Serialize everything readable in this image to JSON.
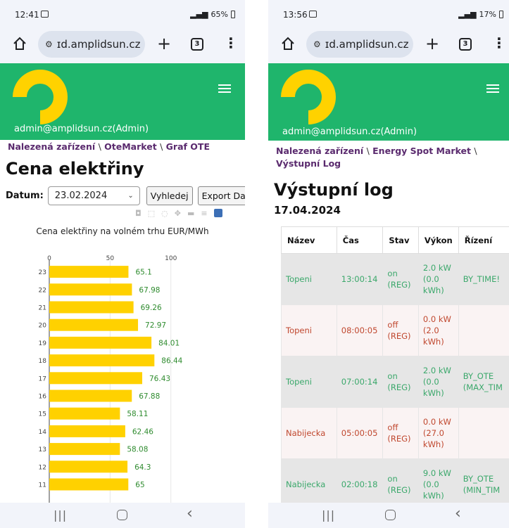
{
  "left": {
    "status": {
      "time": "12:41",
      "right": "65%"
    },
    "url": "ɪd.amplidsun.cz",
    "tab_count": "3",
    "admin": "admin@amplidsun.cz(Admin)",
    "breadcrumbs": [
      "Nalezená zařízení",
      "OteMarket",
      "Graf OTE"
    ],
    "title": "Cena elektřiny",
    "date_label": "Datum:",
    "date_value": "23.02.2024",
    "search_button": "Vyhledej",
    "export_button": "Export Dat",
    "chart_data": {
      "type": "bar",
      "orientation": "horizontal",
      "title": "Cena elektřiny na volném trhu EUR/MWh",
      "xlim": [
        0,
        110
      ],
      "x_ticks": [
        "0",
        "50",
        "100"
      ],
      "categories": [
        "23",
        "22",
        "21",
        "20",
        "19",
        "18",
        "17",
        "16",
        "15",
        "14",
        "13",
        "12",
        "11"
      ],
      "values": [
        65.1,
        67.98,
        69.26,
        72.97,
        84.01,
        86.44,
        76.43,
        67.88,
        58.11,
        62.46,
        58.08,
        64.3,
        65
      ],
      "labels": [
        "65.1",
        "67.98",
        "69.26",
        "72.97",
        "84.01",
        "86.44",
        "76.43",
        "67.88",
        "58.11",
        "62.46",
        "58.08",
        "64.3",
        "65"
      ],
      "bar_color": "#ffd100",
      "label_color": "#2e8b2e",
      "grid": true
    }
  },
  "right": {
    "status": {
      "time": "13:56",
      "right": "17%"
    },
    "url": "ɪd.amplidsun.cz",
    "tab_count": "3",
    "admin": "admin@amplidsun.cz(Admin)",
    "breadcrumbs": [
      "Nalezená zařízení",
      "Energy Spot Market",
      "Výstupní Log"
    ],
    "title": "Výstupní log",
    "date": "17.04.2024",
    "table": {
      "headers": [
        "Název",
        "Čas",
        "Stav",
        "Výkon",
        "Řízení"
      ],
      "rows": [
        {
          "state": "on",
          "cells": [
            "Topeni",
            "13:00:14",
            "on (REG)",
            "2.0 kW (0.0 kWh)",
            "BY_TIME!"
          ]
        },
        {
          "state": "off",
          "cells": [
            "Topeni",
            "08:00:05",
            "off (REG)",
            "0.0 kW (2.0 kWh)",
            ""
          ]
        },
        {
          "state": "on",
          "cells": [
            "Topeni",
            "07:00:14",
            "on (REG)",
            "2.0 kW (0.0 kWh)",
            "BY_OTE (MAX_TIM"
          ]
        },
        {
          "state": "off",
          "cells": [
            "Nabijecka",
            "05:00:05",
            "off (REG)",
            "0.0 kW (27.0 kWh)",
            ""
          ]
        },
        {
          "state": "on",
          "cells": [
            "Nabijecka",
            "02:00:18",
            "on (REG)",
            "9.0 kW (0.0 kWh)",
            "BY_OTE (MIN_TIM"
          ]
        }
      ]
    }
  },
  "colors": {
    "brand_green": "#1fb56c",
    "logo_yellow": "#ffd200",
    "crumb_purple": "#5a2a6e"
  }
}
